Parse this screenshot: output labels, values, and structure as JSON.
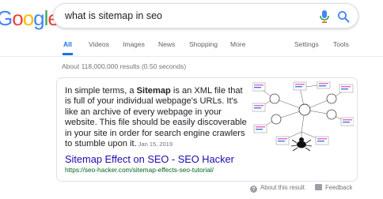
{
  "logo": {
    "letters": [
      "G",
      "o",
      "o",
      "g",
      "l",
      "e"
    ],
    "colors": [
      "#4285F4",
      "#EA4335",
      "#FBBC05",
      "#4285F4",
      "#34A853",
      "#EA4335"
    ]
  },
  "search": {
    "query": "what is sitemap in seo"
  },
  "tabs": [
    "All",
    "Videos",
    "Images",
    "News",
    "Shopping",
    "More",
    "Settings",
    "Tools"
  ],
  "stats": "About 118,000,000 results (0.50 seconds)",
  "snippet": {
    "pre": "In simple terms, a ",
    "bold": "Sitemap",
    "post": " is an XML file that is full of your individual webpage's URLs. It's like an archive of every webpage in your website. This file should be easily discoverable in your site in order for search engine crawlers to stumble upon it.",
    "date": "Jan 15, 2019"
  },
  "result": {
    "title": "Sitemap Effect on SEO - SEO Hacker",
    "url": "https://seo-hacker.com/sitemap-effects-seo-tutorial/"
  },
  "footer": {
    "about": "About this result",
    "feedback": "Feedback"
  },
  "colors": {
    "accent": "#1a73e8",
    "link": "#1a0dab",
    "url": "#006621"
  }
}
